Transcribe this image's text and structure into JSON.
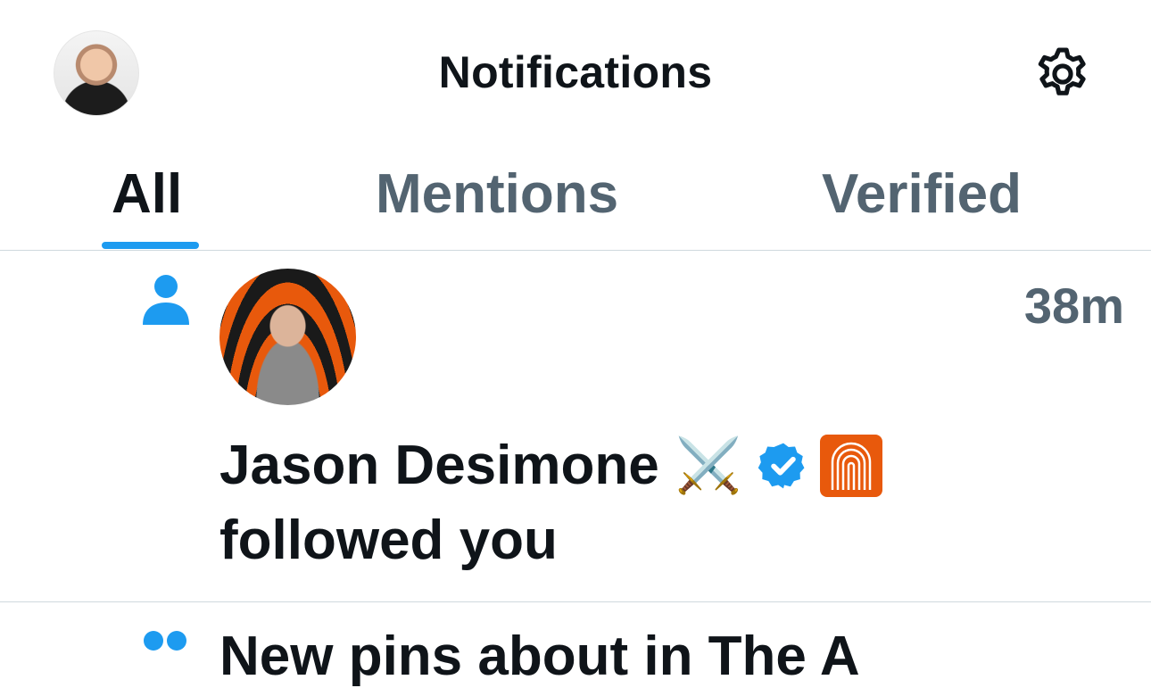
{
  "header": {
    "title": "Notifications",
    "profile_avatar": "profile-avatar",
    "settings_icon": "gear-icon"
  },
  "tabs": [
    {
      "label": "All",
      "active": true
    },
    {
      "label": "Mentions",
      "active": false
    },
    {
      "label": "Verified",
      "active": false
    }
  ],
  "notifications": [
    {
      "type_icon": "person-icon",
      "user_name": "Jason Desimone",
      "name_emoji": "⚔️",
      "verified_badge": "verified-badge-icon",
      "affiliate_badge": "affiliate-badge-icon",
      "action": "followed you",
      "time": "38m"
    },
    {
      "type_icon": "people-icon",
      "text_partial": "New pins about in The A"
    }
  ],
  "colors": {
    "accent": "#1d9bf0",
    "text_primary": "#0f1419",
    "text_secondary": "#536471",
    "divider": "#cfd9de",
    "affiliate_orange": "#e8590c"
  }
}
